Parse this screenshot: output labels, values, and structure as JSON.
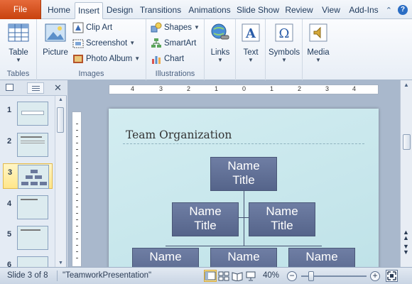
{
  "ribbon": {
    "tabs": [
      "File",
      "Home",
      "Insert",
      "Design",
      "Transitions",
      "Animations",
      "Slide Show",
      "Review",
      "View",
      "Add-Ins"
    ],
    "active_tab": "Insert",
    "groups": {
      "tables": {
        "label": "Tables",
        "table_label": "Table"
      },
      "images": {
        "label": "Images",
        "picture_label": "Picture",
        "clip_art": "Clip Art",
        "screenshot": "Screenshot",
        "photo_album": "Photo Album"
      },
      "illustrations": {
        "label": "Illustrations",
        "shapes": "Shapes",
        "smartart": "SmartArt",
        "chart": "Chart"
      },
      "links": {
        "label": "Links"
      },
      "text": {
        "label": "Text"
      },
      "symbols": {
        "label": "Symbols"
      },
      "media": {
        "label": "Media"
      }
    }
  },
  "thumbnails": [
    {
      "number": "1"
    },
    {
      "number": "2"
    },
    {
      "number": "3"
    },
    {
      "number": "4"
    },
    {
      "number": "5"
    },
    {
      "number": "6"
    }
  ],
  "ruler": {
    "h_labels": [
      "4",
      "3",
      "2",
      "1",
      "0",
      "1",
      "2",
      "3",
      "4"
    ]
  },
  "slide": {
    "title": "Team Organization",
    "org_boxes": [
      {
        "line1": "Name",
        "line2": "Title"
      },
      {
        "line1": "Name",
        "line2": "Title"
      },
      {
        "line1": "Name",
        "line2": "Title"
      },
      {
        "line1": "Name",
        "line2": ""
      },
      {
        "line1": "Name",
        "line2": ""
      },
      {
        "line1": "Name",
        "line2": ""
      }
    ]
  },
  "status": {
    "slide_indicator": "Slide 3 of 8",
    "theme": "\"TeamworkPresentation\"",
    "zoom": "40%"
  }
}
